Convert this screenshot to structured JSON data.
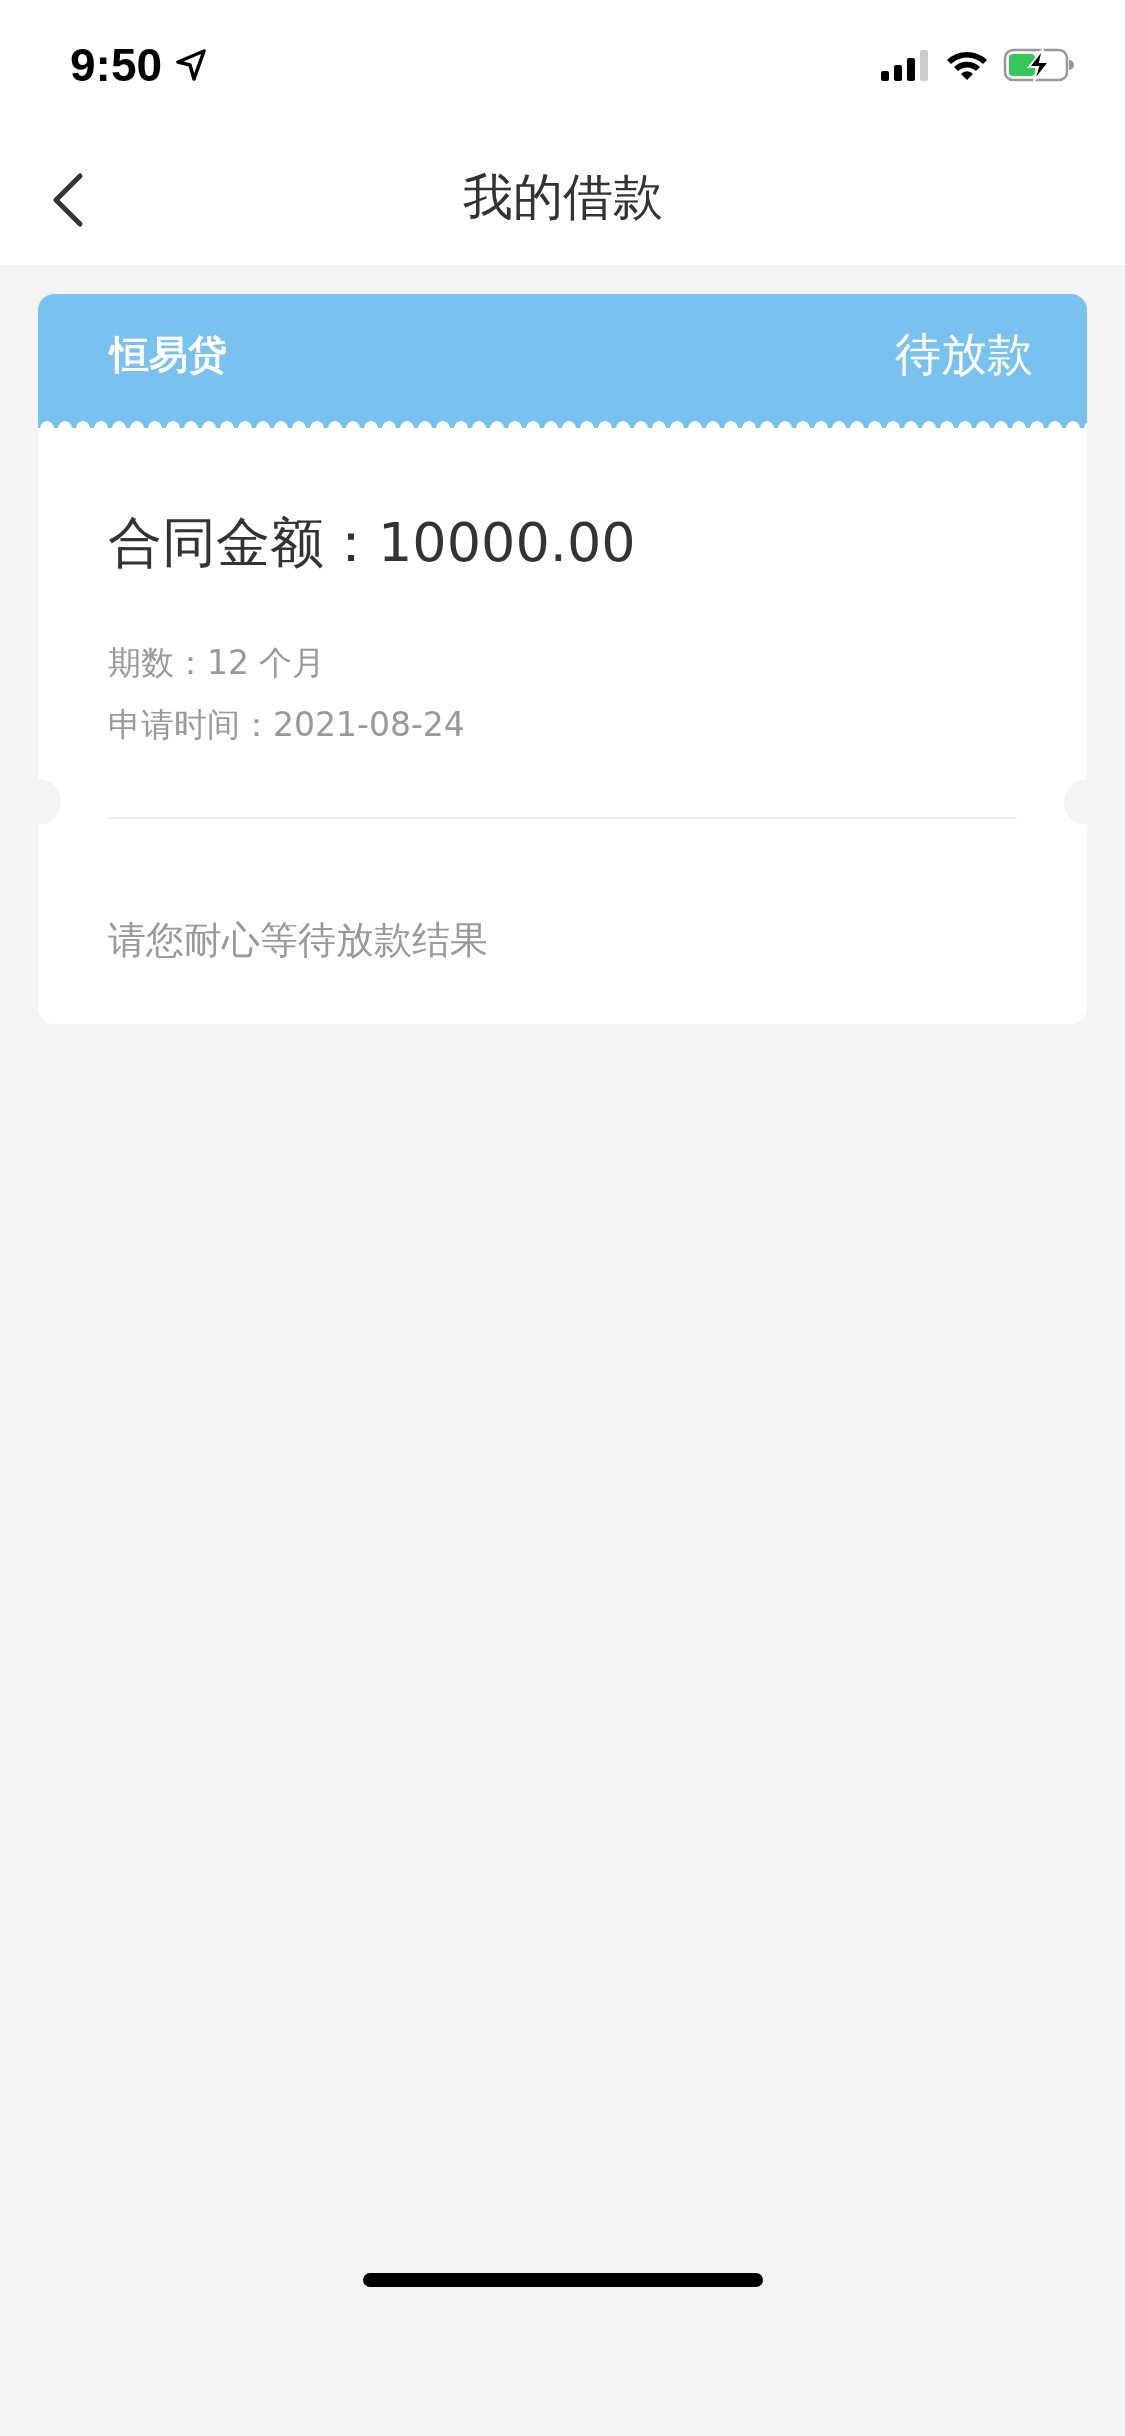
{
  "status_bar": {
    "time": "9:50"
  },
  "nav": {
    "title": "我的借款"
  },
  "loan": {
    "lender": "恒易贷",
    "status": "待放款",
    "amount": "合同金额：10000.00",
    "details": [
      "期数：12 个月",
      "申请时间：2021-08-24"
    ],
    "message": "请您耐心等待放款结果"
  }
}
